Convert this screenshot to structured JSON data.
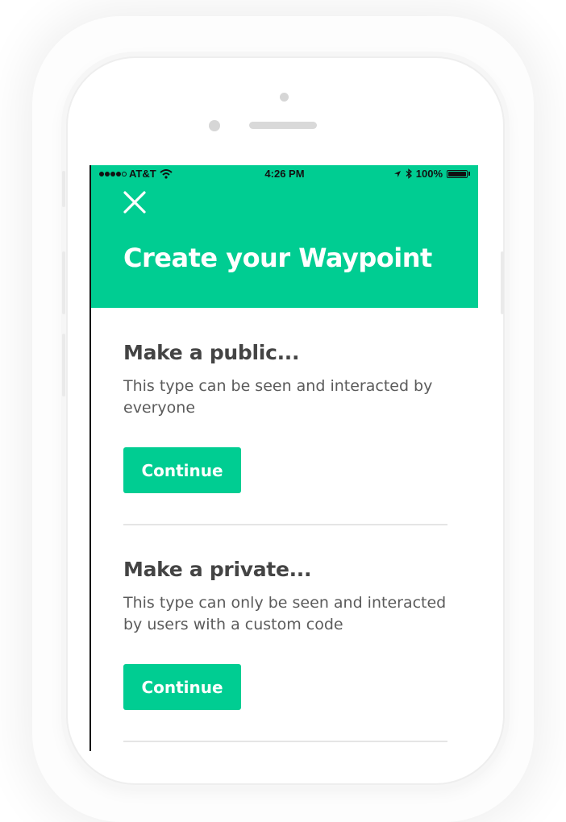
{
  "status_bar": {
    "carrier": "AT&T",
    "time": "4:26 PM",
    "battery": "100%"
  },
  "header": {
    "title": "Create your Waypoint",
    "close_icon": "close-icon",
    "background_color": "#00cd92"
  },
  "options": [
    {
      "heading": "Make a public...",
      "description": "This type can be seen and interacted by everyone",
      "button_label": "Continue"
    },
    {
      "heading": "Make a private...",
      "description": "This type can only be seen and interacted by users with a custom code",
      "button_label": "Continue"
    }
  ],
  "colors": {
    "accent": "#00cd92",
    "heading_text": "#444444",
    "body_text": "#5b5b5b"
  }
}
